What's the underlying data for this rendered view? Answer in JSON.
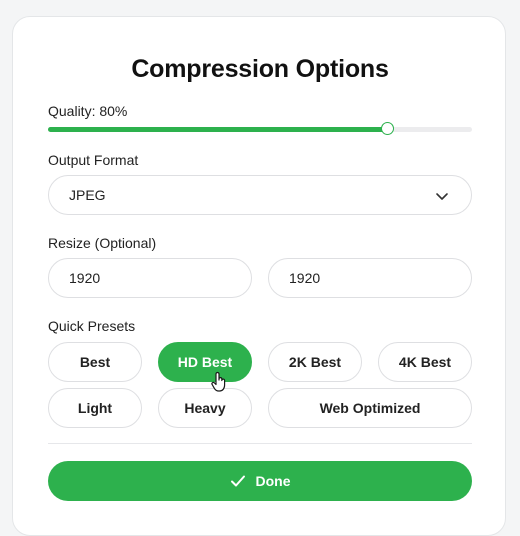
{
  "title": "Compression Options",
  "quality": {
    "label": "Quality: 80%",
    "value": 0.8
  },
  "output_format": {
    "label": "Output Format",
    "value": "JPEG",
    "icon": "chevron-down-icon"
  },
  "resize": {
    "label": "Resize (Optional)",
    "width": "1920",
    "height": "1920"
  },
  "presets": {
    "label": "Quick Presets",
    "items": [
      "Best",
      "HD Best",
      "2K Best",
      "4K Best",
      "Light",
      "Heavy",
      "Web Optimized"
    ],
    "selected": "HD Best"
  },
  "done": {
    "label": "Done",
    "icon": "check-icon"
  },
  "colors": {
    "accent": "#2db14d"
  }
}
